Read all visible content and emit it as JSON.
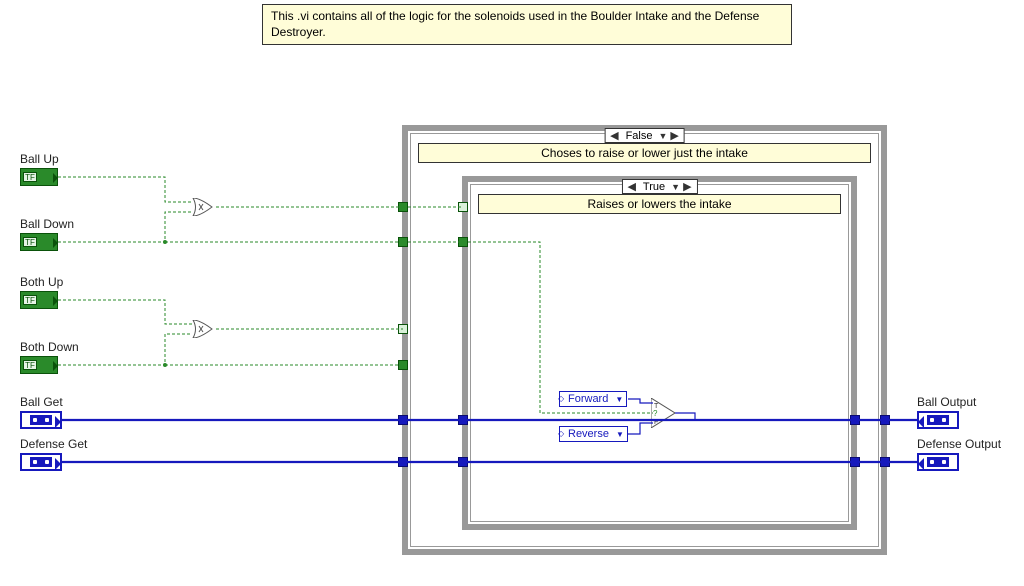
{
  "comment": {
    "text": "This .vi contains all of the logic for the solenoids used in the Boulder Intake and the Defense Destroyer."
  },
  "inputs": {
    "ball_up": {
      "label": "Ball Up",
      "tf": "TF"
    },
    "ball_down": {
      "label": "Ball Down",
      "tf": "TF"
    },
    "both_up": {
      "label": "Both Up",
      "tf": "TF"
    },
    "both_down": {
      "label": "Both Down",
      "tf": "TF"
    },
    "ball_get": {
      "label": "Ball Get"
    },
    "defense_get": {
      "label": "Defense Get"
    }
  },
  "outputs": {
    "ball_output": {
      "label": "Ball Output"
    },
    "defense_output": {
      "label": "Defense Output"
    }
  },
  "outer_case": {
    "selector": "False",
    "caption": "Choses to raise or lower just the intake"
  },
  "inner_case": {
    "selector": "True",
    "caption": "Raises or lowers the intake"
  },
  "enum_consts": {
    "forward": "Forward",
    "reverse": "Reverse"
  },
  "colors": {
    "bool_wire": "#2a8a2a",
    "ref_wire": "#1619bd",
    "comment_bg": "#fffdd8",
    "frame": "#999999"
  }
}
